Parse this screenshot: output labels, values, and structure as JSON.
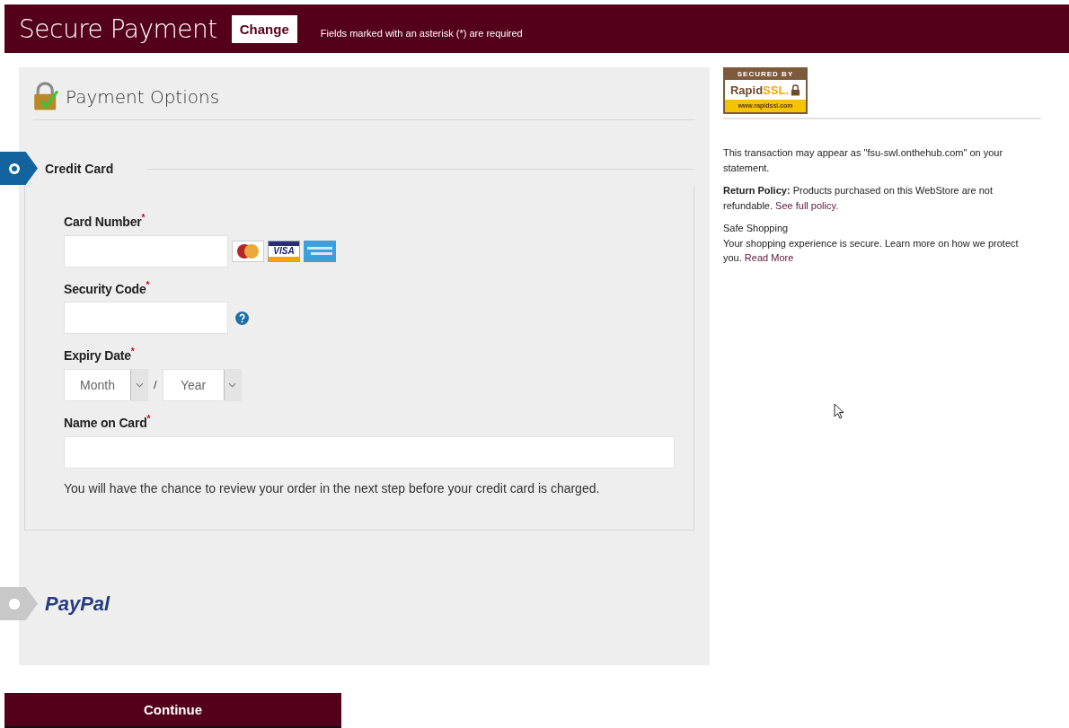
{
  "header": {
    "title": "Secure Payment",
    "change_button": "Change",
    "note": "Fields marked with an asterisk (*) are required"
  },
  "payment_panel": {
    "title": "Payment Options",
    "methods": [
      {
        "kind": "card",
        "label": "Credit Card",
        "selected": true,
        "fields": [
          {
            "kind": "card_number",
            "label": "Card Number",
            "asterisk": "*"
          },
          {
            "kind": "security_code",
            "label": "Security Code",
            "asterisk": "*"
          },
          {
            "kind": "expiry",
            "label": "Expiry Date",
            "asterisk": "*",
            "month": "Month",
            "separator": "/",
            "year": "Year"
          },
          {
            "kind": "wide",
            "label": "Name on Card",
            "asterisk": "*"
          }
        ],
        "card_logos": {
          "visa": "VISA"
        },
        "note": "You will have the chance to review your order in the next step before your credit card is charged."
      },
      {
        "kind": "paypal",
        "label": "PayPal",
        "selected": false
      }
    ]
  },
  "sidebar": {
    "badge": {
      "top": "SECURED BY",
      "brand_dark": "Rapid",
      "brand_light": "SSL.",
      "url": "www.rapidssl.com"
    },
    "statement": "This transaction may appear as \"fsu-swl.onthehub.com\" on your statement.",
    "return_policy": "**Return Policy:** Products purchased on this WebStore are not refundable.",
    "return_link": "See full policy.",
    "safe_title": "Safe Shopping",
    "safe_text": "Your shopping experience is secure. Learn more on how we protect you.",
    "safe_link": "Read More"
  },
  "continue_button": "Continue"
}
